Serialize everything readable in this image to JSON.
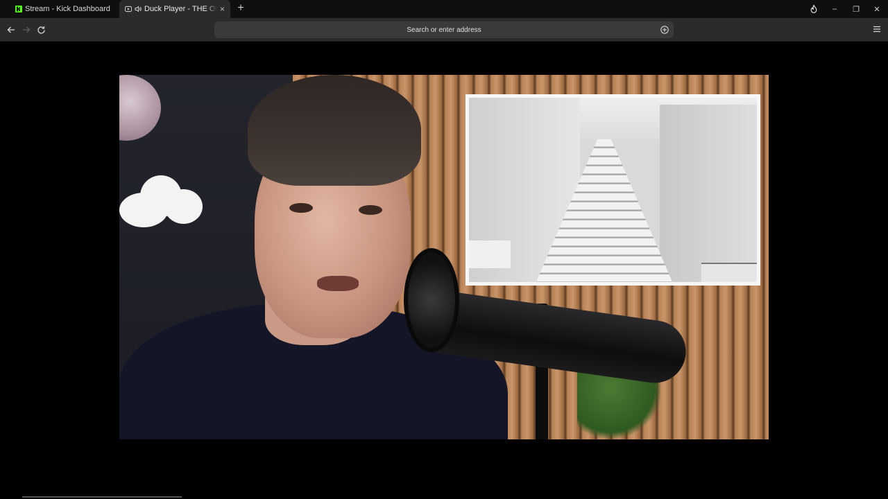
{
  "tabs": [
    {
      "title": "Stream - Kick Dashboard",
      "favicon": "kick-logo-icon",
      "active": false
    },
    {
      "title": "Duck Player - THE ONE Fa",
      "favicon": "youtube-play-icon",
      "audio_icon": "speaker-icon",
      "active": true,
      "close_label": "×"
    }
  ],
  "tabstrip": {
    "new_tab_label": "+",
    "window_controls": {
      "fire": "fire-icon",
      "minimize": "–",
      "restore": "❐",
      "close": "✕"
    }
  },
  "toolbar": {
    "address_placeholder": "Search or enter address"
  },
  "colors": {
    "kick_green": "#53fc18",
    "tab_bg": "#0f0f10",
    "toolbar_bg": "#2b2b2d",
    "address_bg": "#3a3a3c",
    "fire_orange": "#ff6a2c"
  }
}
